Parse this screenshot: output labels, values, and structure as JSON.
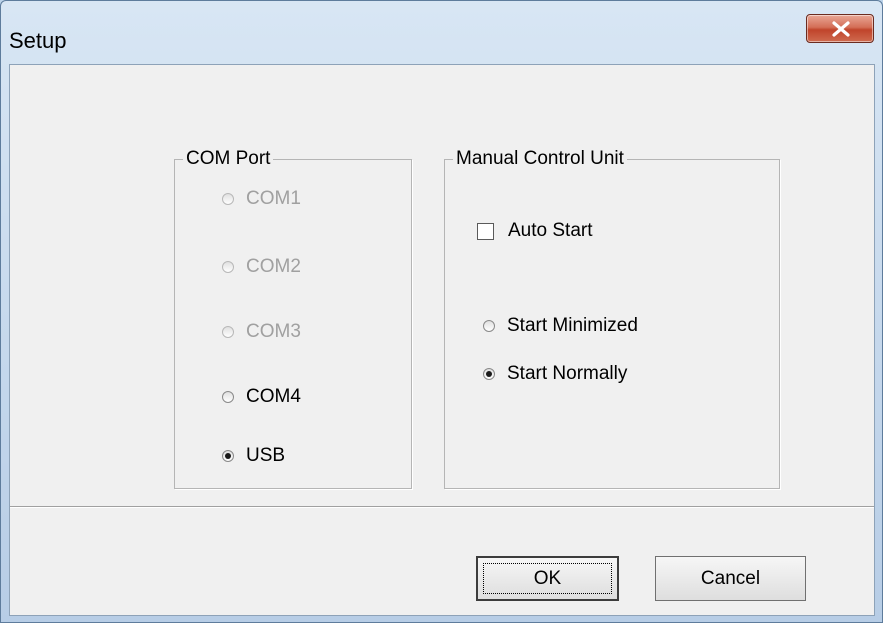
{
  "window": {
    "title": "Setup"
  },
  "com_port": {
    "legend": "COM Port",
    "options": [
      {
        "label": "COM1",
        "selected": false,
        "disabled": true
      },
      {
        "label": "COM2",
        "selected": false,
        "disabled": true
      },
      {
        "label": "COM3",
        "selected": false,
        "disabled": true
      },
      {
        "label": "COM4",
        "selected": false,
        "disabled": false
      },
      {
        "label": "USB",
        "selected": true,
        "disabled": false
      }
    ]
  },
  "manual_control": {
    "legend": "Manual Control Unit",
    "auto_start_label": "Auto Start",
    "auto_start_checked": false,
    "start_minimized_label": "Start Minimized",
    "start_normally_label": "Start Normally",
    "selected_mode": "Start Normally"
  },
  "buttons": {
    "ok_label": "OK",
    "cancel_label": "Cancel"
  },
  "colors": {
    "close_button": "#c0442b",
    "client_bg": "#f0f0f0",
    "disabled_text": "#a0a0a0"
  }
}
